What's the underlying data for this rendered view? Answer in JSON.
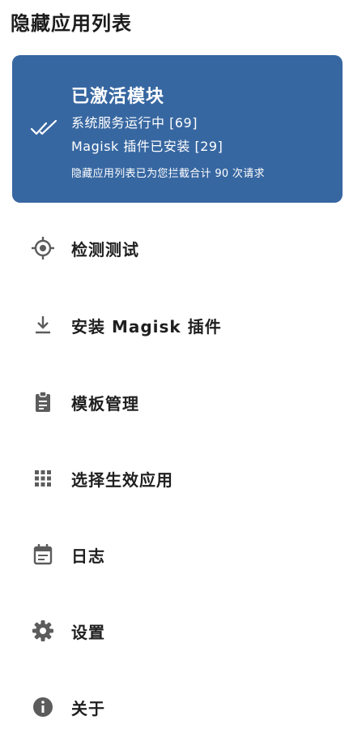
{
  "app": {
    "title": "隐藏应用列表"
  },
  "status_card": {
    "title": "已激活模块",
    "service_status": "系统服务运行中 [69]",
    "magisk_status": "Magisk 插件已安装 [29]",
    "intercept_summary": "隐藏应用列表已为您拦截合计 90 次请求",
    "color": "#3767a1"
  },
  "menu": {
    "items": [
      {
        "label": "检测测试",
        "icon": "target-icon"
      },
      {
        "label": "安装 Magisk 插件",
        "icon": "download-icon"
      },
      {
        "label": "模板管理",
        "icon": "clipboard-icon"
      },
      {
        "label": "选择生效应用",
        "icon": "apps-grid-icon"
      },
      {
        "label": "日志",
        "icon": "calendar-icon"
      },
      {
        "label": "设置",
        "icon": "gear-icon"
      },
      {
        "label": "关于",
        "icon": "info-icon"
      }
    ]
  },
  "colors": {
    "icon": "#5c5c5c",
    "text": "#1f1f1f"
  }
}
